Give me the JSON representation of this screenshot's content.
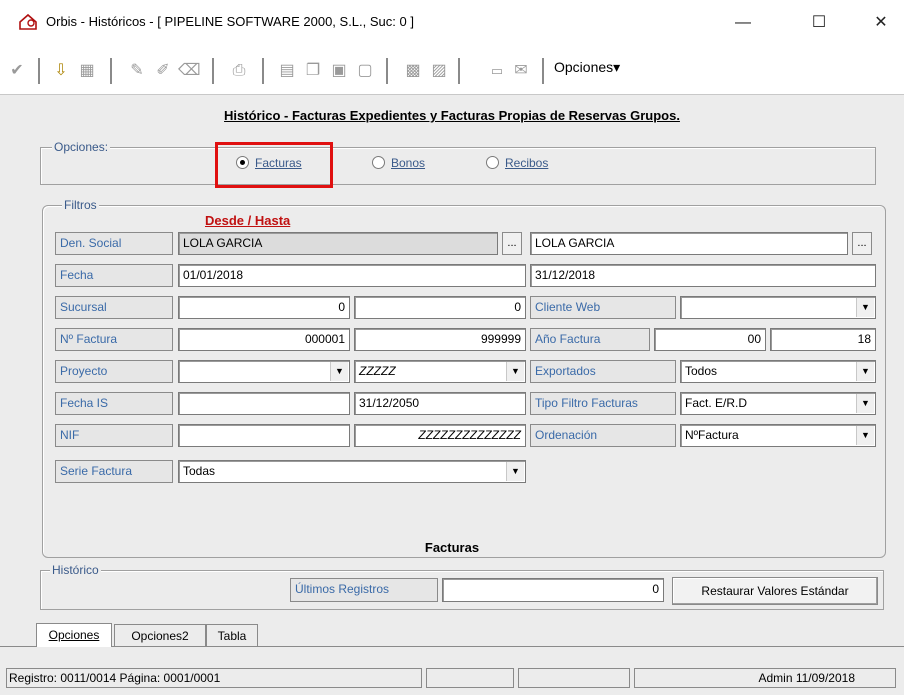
{
  "window": {
    "title": "Orbis - Históricos - [ PIPELINE SOFTWARE 2000, S.L.,  Suc: 0 ]",
    "minimize": "—",
    "maximize": "☐",
    "close": "✕"
  },
  "toolbar": {
    "menu_label": "Opciones▾"
  },
  "heading": "Histórico - Facturas Expedientes y Facturas Propias de Reservas Grupos.",
  "opciones": {
    "label": "Opciones:",
    "radios": [
      {
        "label": "Facturas",
        "selected": true
      },
      {
        "label": "Bonos",
        "selected": false
      },
      {
        "label": "Recibos",
        "selected": false
      }
    ]
  },
  "filtros": {
    "label": "Filtros",
    "range_caption": "Desde / Hasta",
    "den_social": {
      "label": "Den. Social",
      "from": "LOLA GARCIA",
      "to": "LOLA GARCIA",
      "btn": "..."
    },
    "fecha": {
      "label": "Fecha",
      "from": "01/01/2018",
      "to": "31/12/2018"
    },
    "sucursal": {
      "label": "Sucursal",
      "from": "0",
      "to": "0"
    },
    "cliente_web": {
      "label": "Cliente Web",
      "value": ""
    },
    "n_factura": {
      "label": "Nº Factura",
      "from": "000001",
      "to": "999999"
    },
    "anio_factura": {
      "label": "Año Factura",
      "from": "00",
      "to": "18"
    },
    "proyecto": {
      "label": "Proyecto",
      "from": "",
      "to": "ZZZZZ"
    },
    "exportados": {
      "label": "Exportados",
      "value": "Todos"
    },
    "fecha_is": {
      "label": "Fecha IS",
      "from": "",
      "to": "31/12/2050"
    },
    "tipo_filtro": {
      "label": "Tipo Filtro Facturas",
      "value": "Fact. E/R.D"
    },
    "nif": {
      "label": "NIF",
      "from": "",
      "to": "ZZZZZZZZZZZZZZ"
    },
    "ordenacion": {
      "label": "Ordenación",
      "value": "NºFactura"
    },
    "serie_factura": {
      "label": "Serie Factura",
      "value": "Todas"
    },
    "footer_title": "Facturas"
  },
  "historico": {
    "label": "Histórico",
    "ultimos_label": "Últimos Registros",
    "ultimos_value": "0",
    "restore_button": "Restaurar Valores Estándar"
  },
  "tabs": [
    "Opciones",
    "Opciones2",
    "Tabla"
  ],
  "status": {
    "registro": "Registro: 0011/0014  Página: 0001/0001",
    "cell2": "",
    "cell3": "",
    "user_date": "Admin 11/09/2018"
  }
}
